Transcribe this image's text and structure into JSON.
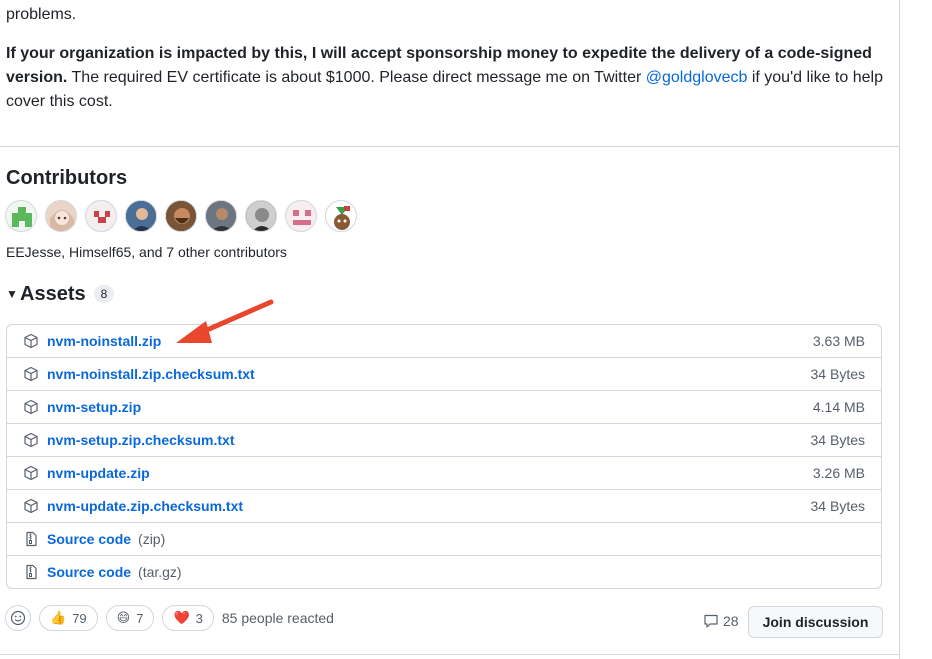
{
  "intro": {
    "line1": "problems.",
    "bold_text": "If your organization is impacted by this, I will accept sponsorship money to expedite the delivery of a code-signed version.",
    "normal_text": " The required EV certificate is about $1000. Please direct message me on Twitter ",
    "handle": "@goldglovecb",
    "tail_text": " if you'd like to help cover this cost."
  },
  "contributors": {
    "title": "Contributors",
    "summary": "EEJesse, Himself65, and 7 other contributors",
    "avatars": [
      "avatar-1",
      "avatar-2",
      "avatar-3",
      "avatar-4",
      "avatar-5",
      "avatar-6",
      "avatar-7",
      "avatar-8",
      "avatar-9"
    ]
  },
  "assets": {
    "title": "Assets",
    "count": "8",
    "items": [
      {
        "name": "nvm-noinstall.zip",
        "size": "3.63 MB",
        "icon": "package-icon"
      },
      {
        "name": "nvm-noinstall.zip.checksum.txt",
        "size": "34 Bytes",
        "icon": "package-icon"
      },
      {
        "name": "nvm-setup.zip",
        "size": "4.14 MB",
        "icon": "package-icon"
      },
      {
        "name": "nvm-setup.zip.checksum.txt",
        "size": "34 Bytes",
        "icon": "package-icon"
      },
      {
        "name": "nvm-update.zip",
        "size": "3.26 MB",
        "icon": "package-icon"
      },
      {
        "name": "nvm-update.zip.checksum.txt",
        "size": "34 Bytes",
        "icon": "package-icon"
      },
      {
        "name": "Source code",
        "sub": "(zip)",
        "icon": "file-zip-icon"
      },
      {
        "name": "Source code",
        "sub": "(tar.gz)",
        "icon": "file-zip-icon"
      }
    ]
  },
  "reactions": {
    "thumbs_up": "👍",
    "thumbs_up_count": "79",
    "laugh": "😄",
    "laugh_count": "7",
    "heart": "❤️",
    "heart_count": "3",
    "summary": "85 people reacted"
  },
  "discussion": {
    "comment_count": "28",
    "join_label": "Join discussion"
  },
  "colors": {
    "link": "#0969da",
    "border": "#d0d7de",
    "arrow": "#e8472e"
  }
}
